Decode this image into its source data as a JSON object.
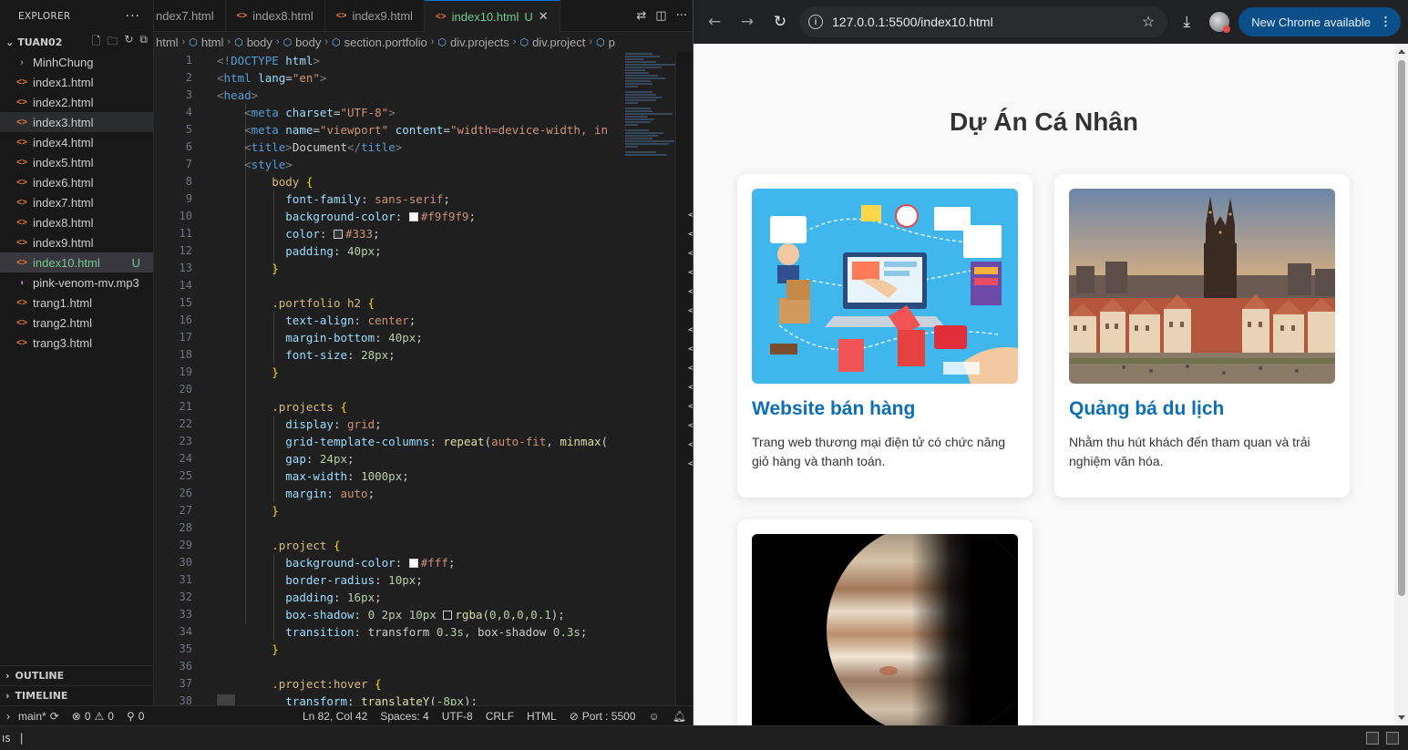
{
  "explorer": {
    "title": "EXPLORER",
    "folder": "TUAN02",
    "files": [
      {
        "name": "MinhChung",
        "kind": "folder"
      },
      {
        "name": "index1.html",
        "kind": "html"
      },
      {
        "name": "index2.html",
        "kind": "html"
      },
      {
        "name": "index3.html",
        "kind": "html",
        "state": "hover"
      },
      {
        "name": "index4.html",
        "kind": "html"
      },
      {
        "name": "index5.html",
        "kind": "html"
      },
      {
        "name": "index6.html",
        "kind": "html"
      },
      {
        "name": "index7.html",
        "kind": "html"
      },
      {
        "name": "index8.html",
        "kind": "html"
      },
      {
        "name": "index9.html",
        "kind": "html"
      },
      {
        "name": "index10.html",
        "kind": "html",
        "state": "active",
        "badge": "U"
      },
      {
        "name": "pink-venom-mv.mp3",
        "kind": "mp3"
      },
      {
        "name": "trang1.html",
        "kind": "html"
      },
      {
        "name": "trang2.html",
        "kind": "html"
      },
      {
        "name": "trang3.html",
        "kind": "html"
      }
    ],
    "outline": "OUTLINE",
    "timeline": "TIMELINE"
  },
  "tabs": [
    {
      "label": "ndex7.html"
    },
    {
      "label": "index8.html"
    },
    {
      "label": "index9.html"
    },
    {
      "label": "index10.html",
      "active": true,
      "badge": "U"
    }
  ],
  "breadcrumb": [
    "html",
    "html",
    "body",
    "body",
    "section.portfolio",
    "div.projects",
    "div.project",
    "p"
  ],
  "editor": {
    "line_numbers": [
      "1",
      "2",
      "3",
      "4",
      "5",
      "6",
      "7",
      "8",
      "9",
      "10",
      "11",
      "12",
      "13",
      "14",
      "15",
      "16",
      "17",
      "18",
      "19",
      "20",
      "21",
      "22",
      "23",
      "24",
      "25",
      "26",
      "27",
      "28",
      "29",
      "30",
      "31",
      "32",
      "33",
      "34",
      "35",
      "36",
      "37",
      "38"
    ]
  },
  "statusbar": {
    "branch": "main*",
    "errors": "0",
    "warnings": "0",
    "ports_count": "0",
    "position": "Ln 82, Col 42",
    "spaces": "Spaces: 4",
    "encoding": "UTF-8",
    "eol": "CRLF",
    "language": "HTML",
    "port": "Port : 5500"
  },
  "terminal": {
    "label": "ıs",
    "cursor": "|"
  },
  "browser": {
    "url": "127.0.0.1:5500/index10.html",
    "new_chrome": "New Chrome available",
    "page": {
      "title": "Dự Án Cá Nhân",
      "projects": [
        {
          "title": "Website bán hàng",
          "desc": "Trang web thương mại điện tử có chức năng giỏ hàng và thanh toán.",
          "image": "ecommerce-illustration"
        },
        {
          "title": "Quảng bá du lịch",
          "desc": "Nhằm thu hút khách đến tham quan và trải nghiệm văn hóa.",
          "image": "prague-old-town"
        },
        {
          "image": "jupiter-planet"
        }
      ]
    }
  },
  "colors": {
    "accent_blue": "#0c6fb5",
    "vscode_bg": "#1f1f1f",
    "active_file": "#73c991",
    "page_bg": "#f9f9f9"
  }
}
